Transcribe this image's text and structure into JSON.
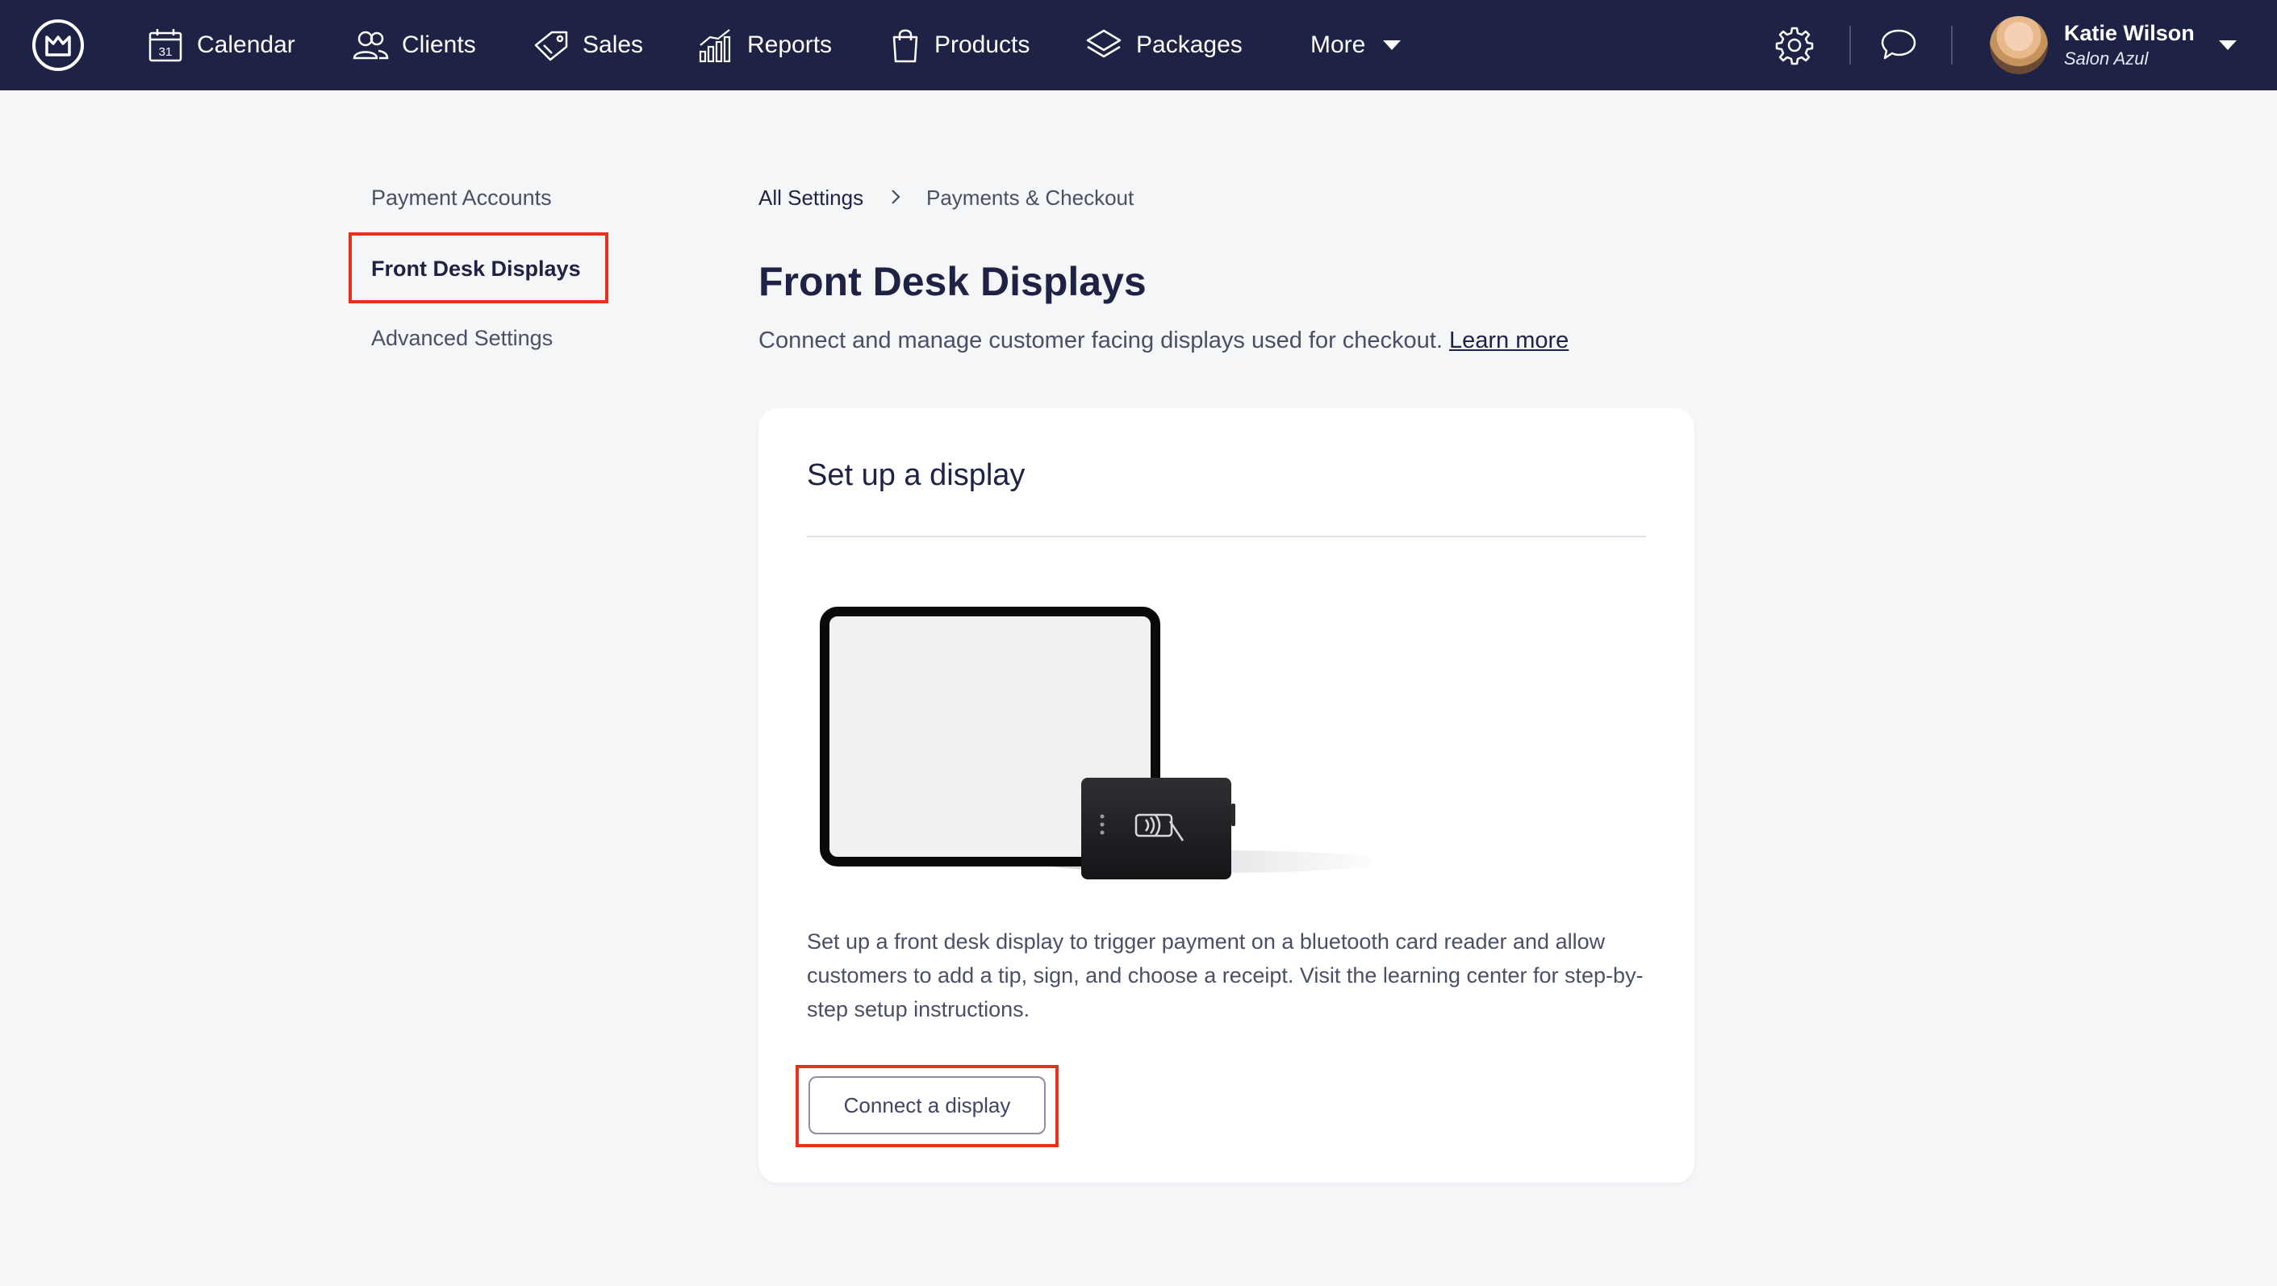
{
  "app": {
    "nav": [
      {
        "label": "Calendar",
        "icon": "calendar-icon"
      },
      {
        "label": "Clients",
        "icon": "users-icon"
      },
      {
        "label": "Sales",
        "icon": "tag-icon"
      },
      {
        "label": "Reports",
        "icon": "bar-chart-icon"
      },
      {
        "label": "Products",
        "icon": "shopping-bag-icon"
      },
      {
        "label": "Packages",
        "icon": "layers-icon"
      },
      {
        "label": "More",
        "icon": "chevron-down-icon"
      }
    ],
    "user": {
      "name": "Katie Wilson",
      "salon": "Salon Azul"
    },
    "colors": {
      "navbar": "#1e2245",
      "highlight": "#e8301c",
      "background": "#f5f6f8"
    }
  },
  "sidebar": {
    "items": [
      {
        "label": "Payment Accounts",
        "active": false
      },
      {
        "label": "Front Desk Displays",
        "active": true
      },
      {
        "label": "Advanced Settings",
        "active": false
      }
    ]
  },
  "breadcrumb": {
    "root": "All Settings",
    "current": "Payments & Checkout"
  },
  "page": {
    "title": "Front Desk Displays",
    "description": "Connect and manage customer facing displays used for checkout.",
    "learn_more": "Learn more"
  },
  "card": {
    "title": "Set up a display",
    "body": "Set up a front desk display to trigger payment on a bluetooth card reader and allow customers to add a tip, sign, and choose a receipt. Visit the learning center for step-by-step setup instructions.",
    "button": "Connect a display"
  }
}
